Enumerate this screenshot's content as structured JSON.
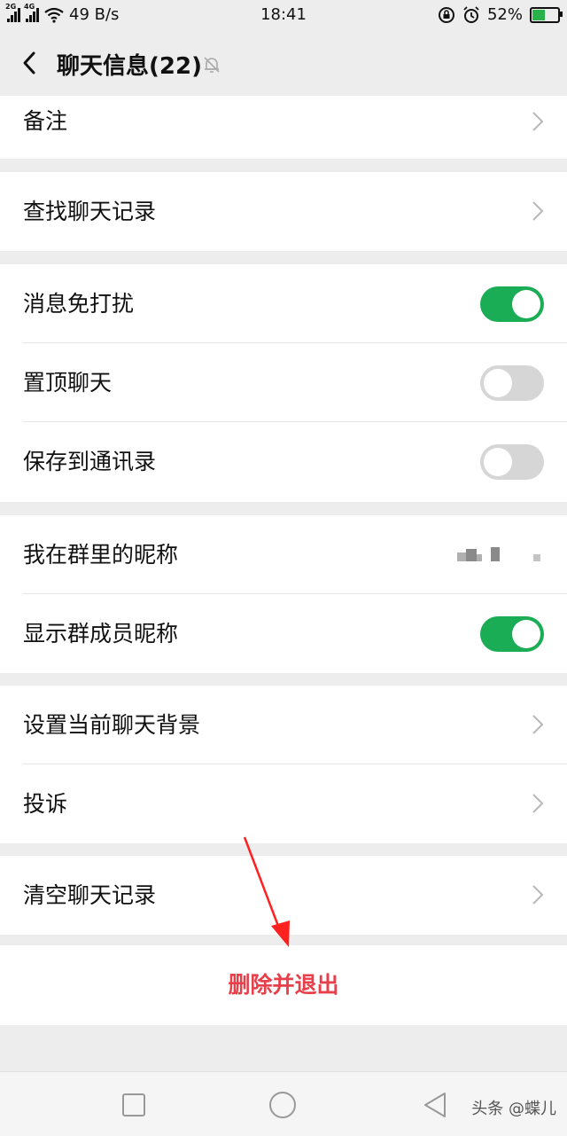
{
  "status_bar": {
    "network_left": "2G",
    "network_right": "4G",
    "speed": "49 B/s",
    "time": "18:41",
    "battery_percent": "52%",
    "battery_level": 0.52
  },
  "header": {
    "title": "聊天信息(22)"
  },
  "groups": {
    "remark": {
      "label": "备注"
    },
    "search_history": {
      "label": "查找聊天记录"
    },
    "mute": {
      "label": "消息免打扰",
      "on": true
    },
    "pin": {
      "label": "置顶聊天",
      "on": false
    },
    "save_contacts": {
      "label": "保存到通讯录",
      "on": false
    },
    "my_nickname": {
      "label": "我在群里的昵称"
    },
    "show_nicknames": {
      "label": "显示群成员昵称",
      "on": true
    },
    "background": {
      "label": "设置当前聊天背景"
    },
    "report": {
      "label": "投诉"
    },
    "clear_history": {
      "label": "清空聊天记录"
    }
  },
  "danger": {
    "label": "删除并退出"
  },
  "watermark": "头条 @蝶儿",
  "colors": {
    "accent": "#1aad55",
    "danger": "#e8404a",
    "annotation_arrow": "#ff2020"
  }
}
